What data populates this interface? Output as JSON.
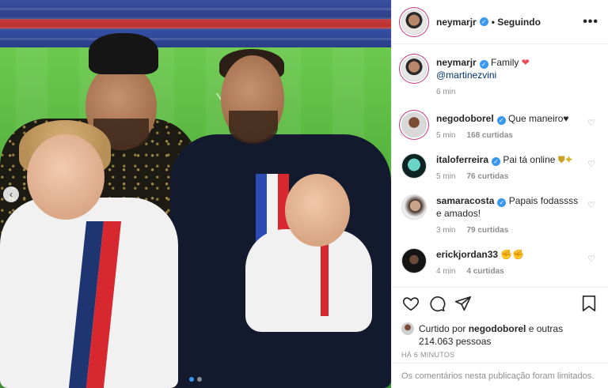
{
  "post": {
    "author": "neymarjr",
    "follow_state": "Seguindo",
    "more_label": "•••",
    "caption": {
      "user": "neymarjr",
      "text": "Family",
      "mention": "@martinezvini",
      "time": "6 min"
    },
    "comments": [
      {
        "user": "negodoborel",
        "text": "Que maneiro♥",
        "time": "5 min",
        "likes": "168 curtidas"
      },
      {
        "user": "italoferreira",
        "text": "Pai tá online",
        "time": "5 min",
        "likes": "76 curtidas"
      },
      {
        "user": "samaracosta",
        "text": "Papais fodassss e amados!",
        "time": "3 min",
        "likes": "79 curtidas"
      },
      {
        "user": "erickjordan33",
        "text": "",
        "time": "4 min",
        "likes": "4 curtidas"
      }
    ],
    "liked_by": {
      "prefix": "Curtido por",
      "user": "negodoborel",
      "rest": "e outras 214.063 pessoas"
    },
    "timestamp": "HÁ 6 MINUTOS",
    "comments_limited": "Os comentários nesta publicação foram limitados."
  },
  "carousel": {
    "prev_icon": "chevron-left-icon",
    "total_slides": 2,
    "active_slide": 1
  },
  "colors": {
    "verified": "#3897f0",
    "heart": "#ed4956",
    "muted": "#8e8e8e"
  }
}
